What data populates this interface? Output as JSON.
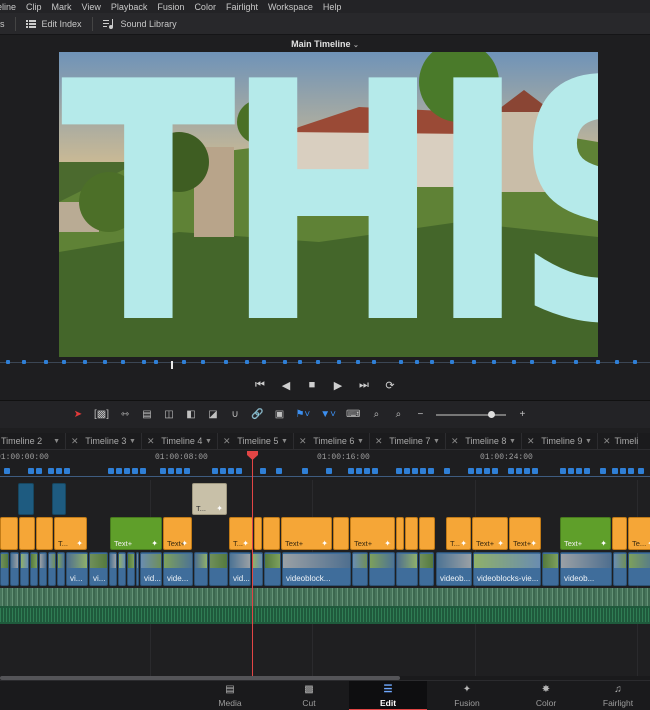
{
  "menu": [
    "eline",
    "Clip",
    "Mark",
    "View",
    "Playback",
    "Fusion",
    "Color",
    "Fairlight",
    "Workspace",
    "Help"
  ],
  "toolbar": {
    "left_cut": "s",
    "edit_index": "Edit Index",
    "sound_library": "Sound Library"
  },
  "viewer": {
    "timeline_name": "Main Timeline",
    "overlay_text": "THIS"
  },
  "scrubber": {
    "marker": "1"
  },
  "tabs": [
    "Timeline 2",
    "Timeline 3",
    "Timeline 4",
    "Timeline 5",
    "Timeline 6",
    "Timeline 7",
    "Timeline 8",
    "Timeline 9",
    "Timeli"
  ],
  "ruler": {
    "timecodes": [
      "01:00:00:00",
      "01:00:08:00",
      "01:00:16:00",
      "01:00:24:00"
    ]
  },
  "clips": {
    "beige_label": "T...",
    "text_label": "Text+",
    "text_short": "T...",
    "text_short2": "Te...",
    "video_labels": [
      "vi...",
      "vi...",
      "vid...",
      "vide...",
      "vid...",
      "videoblock...",
      "videob...",
      "videoblocks-vie...",
      "videob..."
    ]
  },
  "pages": [
    {
      "label": "Media",
      "icon": "media-icon"
    },
    {
      "label": "Cut",
      "icon": "cut-icon"
    },
    {
      "label": "Edit",
      "icon": "edit-icon",
      "active": true
    },
    {
      "label": "Fusion",
      "icon": "fusion-icon"
    },
    {
      "label": "Color",
      "icon": "color-icon"
    },
    {
      "label": "Fairlight",
      "icon": "fairlight-icon"
    }
  ],
  "colors": {
    "accent": "#e24545",
    "marker_blue": "#2f7fd6",
    "text_clip": "#f5a637",
    "text_clip_green": "#5f9f2a",
    "video_clip": "#3f6d9b",
    "overlay_text": "#b5eaea"
  }
}
